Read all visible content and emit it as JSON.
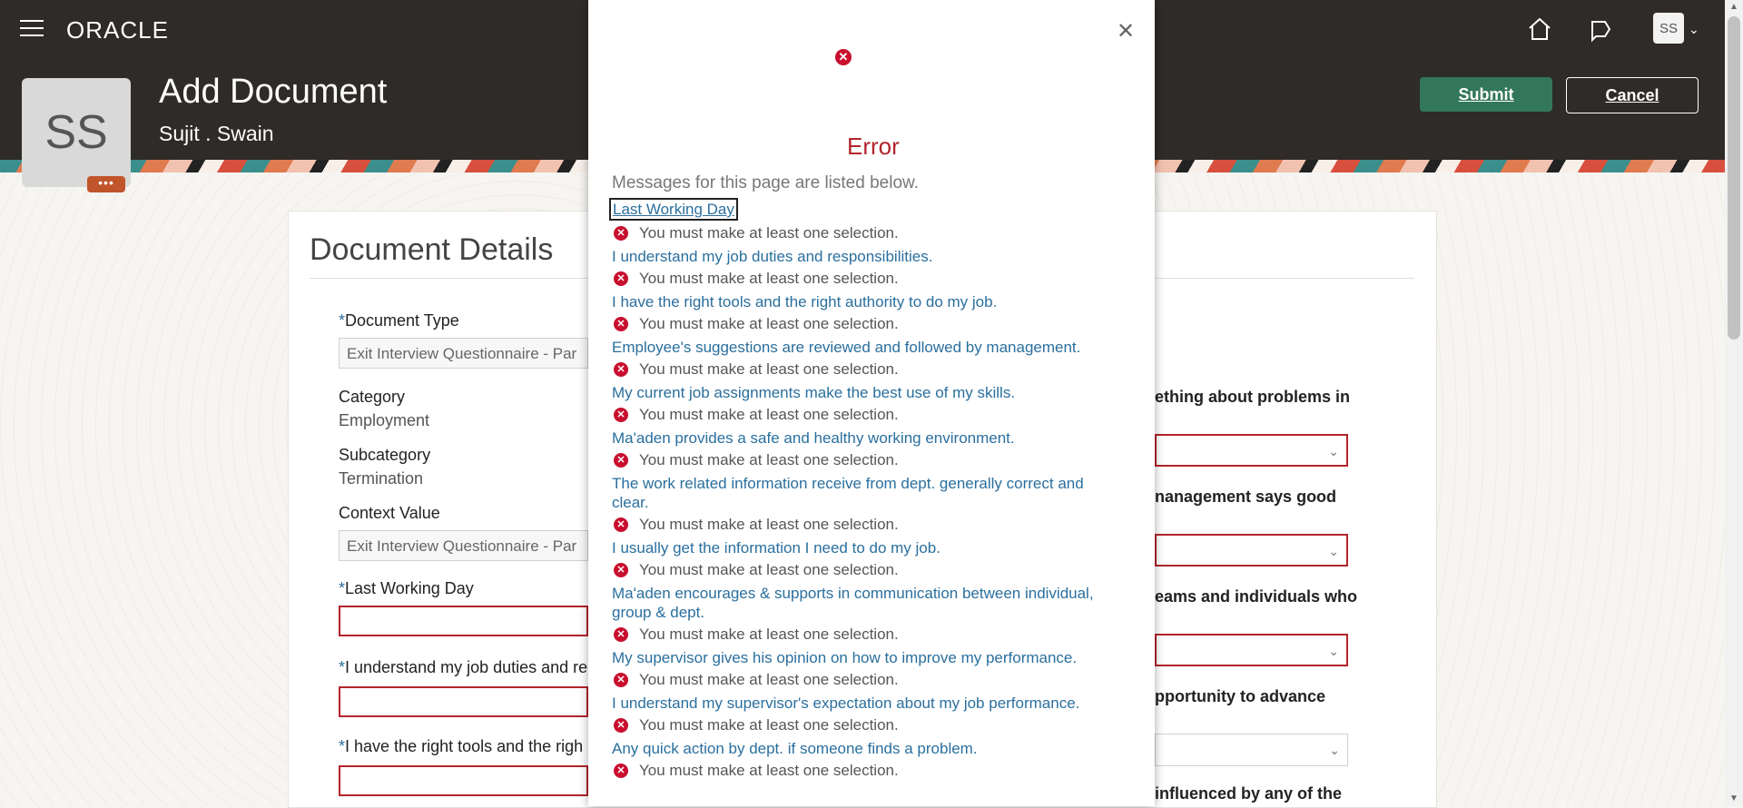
{
  "header": {
    "logo": "ORACLE",
    "page_title": "Add Document",
    "person_name": "Sujit . Swain",
    "avatar_initials": "SS",
    "more_dots": "•••",
    "submit_label": "Submit",
    "cancel_label": "Cancel",
    "icons": [
      "menu-icon",
      "home-icon",
      "notifications-icon",
      "user-menu-chevron-icon"
    ]
  },
  "card": {
    "title": "Document Details",
    "document_type": {
      "label": "Document Type",
      "value": "Exit Interview Questionnaire - Par"
    },
    "category": {
      "label": "Category",
      "value": "Employment"
    },
    "subcategory": {
      "label": "Subcategory",
      "value": "Termination"
    },
    "context_value": {
      "label": "Context Value",
      "value": "Exit Interview Questionnaire - Par"
    },
    "last_working_day": {
      "label": "Last Working Day"
    },
    "understand_duties": {
      "label": "I understand my job duties and re"
    },
    "right_tools": {
      "label": "I have the right tools and the righ"
    },
    "right_col": [
      "ething about problems in",
      "nanagement says good",
      "eams and individuals who",
      "pportunity to advance",
      "influenced by any of the"
    ]
  },
  "dialog": {
    "title": "Error",
    "subtitle": "Messages for this page are listed below.",
    "error_text": "You must make at least one selection.",
    "items": [
      "Last Working Day",
      "I understand my job duties and responsibilities.",
      "I have the right tools and the right authority to do my job.",
      "Employee's suggestions are reviewed and followed by management.",
      "My current job assignments make the best use of my skills.",
      "Ma'aden provides a safe and healthy working environment.",
      "The work related information receive from dept. generally correct and clear.",
      "I usually get the information I need to do my job.",
      "Ma'aden encourages & supports in communication between individual, group & dept.",
      "My supervisor gives his opinion on how to improve my performance.",
      "I understand my supervisor's expectation about my job performance.",
      "Any quick action by dept. if someone finds a problem."
    ]
  },
  "colors": {
    "header_bg": "#2e2b28",
    "submit_bg": "#33775a",
    "error_red": "#b3242c",
    "link_blue": "#2a6f9e"
  }
}
